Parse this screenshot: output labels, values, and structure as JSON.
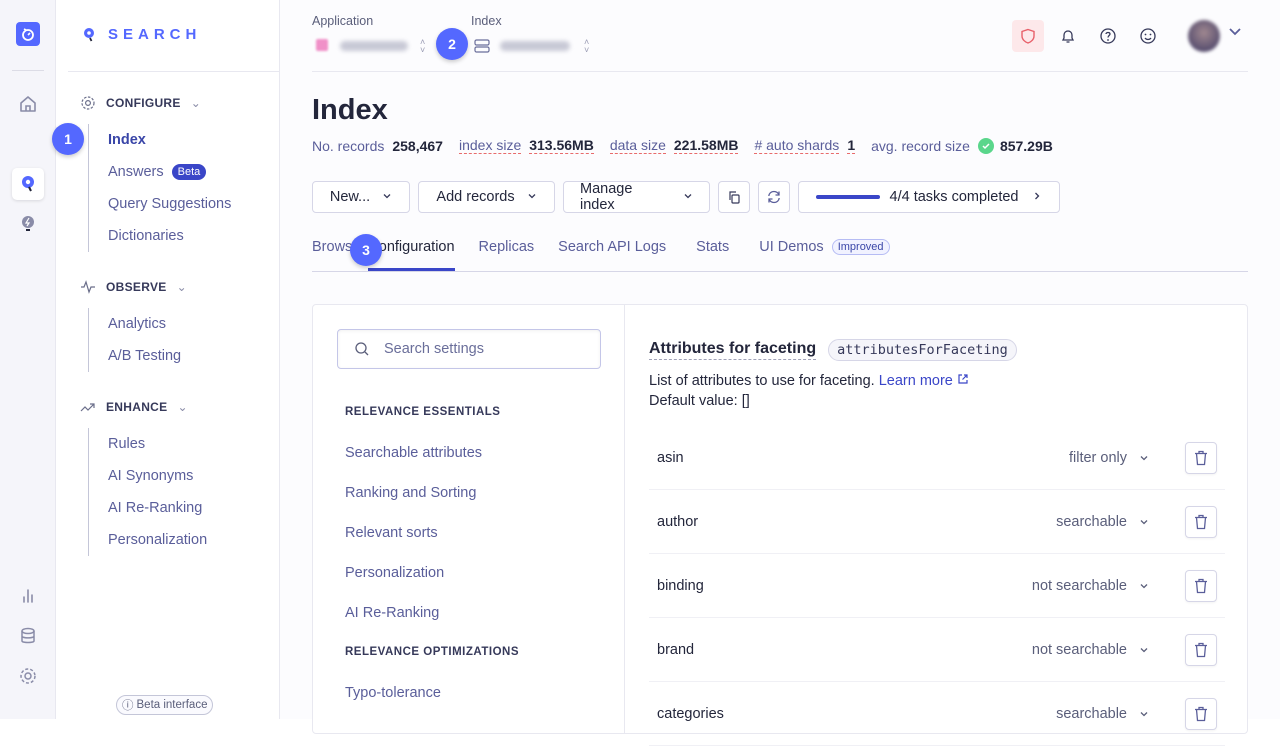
{
  "rail": {
    "icons": [
      "app-logo-icon",
      "home-icon",
      "search-product-icon",
      "ai-bulb-icon",
      "analytics-icon",
      "database-icon",
      "settings-icon"
    ]
  },
  "nav": {
    "logo_text": "SEARCH",
    "sections": [
      {
        "title": "CONFIGURE",
        "items": [
          {
            "label": "Index",
            "selected": true
          },
          {
            "label": "Answers",
            "badge": "Beta"
          },
          {
            "label": "Query Suggestions"
          },
          {
            "label": "Dictionaries"
          }
        ]
      },
      {
        "title": "OBSERVE",
        "items": [
          {
            "label": "Analytics"
          },
          {
            "label": "A/B Testing"
          }
        ]
      },
      {
        "title": "ENHANCE",
        "items": [
          {
            "label": "Rules"
          },
          {
            "label": "AI Synonyms"
          },
          {
            "label": "AI Re-Ranking"
          },
          {
            "label": "Personalization"
          }
        ]
      }
    ],
    "beta_interface": "Beta interface"
  },
  "steps": {
    "one": "1",
    "two": "2",
    "three": "3"
  },
  "topbar": {
    "application_label": "Application",
    "index_label": "Index"
  },
  "page": {
    "title": "Index",
    "stats": {
      "records_label": "No. records",
      "records_value": "258,467",
      "index_size_label": "index size",
      "index_size_value": "313.56MB",
      "data_size_label": "data size",
      "data_size_value": "221.58MB",
      "shards_label": "# auto shards",
      "shards_value": "1",
      "avg_label": "avg. record size",
      "avg_value": "857.29B"
    },
    "toolbar": {
      "new": "New...",
      "add_records": "Add records",
      "manage_index": "Manage index",
      "tasks": "4/4 tasks completed",
      "tasks_progress": 1.0
    },
    "tabs": [
      {
        "label": "Brows"
      },
      {
        "label": "Configuration",
        "selected": true
      },
      {
        "label": "Replicas"
      },
      {
        "label": "Search API Logs"
      },
      {
        "label": "Stats"
      },
      {
        "label": "UI Demos",
        "badge": "Improved"
      }
    ]
  },
  "settings": {
    "search_placeholder": "Search settings",
    "categories": [
      {
        "title": "RELEVANCE ESSENTIALS",
        "items": [
          "Searchable attributes",
          "Ranking and Sorting",
          "Relevant sorts",
          "Personalization",
          "AI Re-Ranking"
        ]
      },
      {
        "title": "RELEVANCE OPTIMIZATIONS",
        "items": [
          "Typo-tolerance"
        ]
      }
    ]
  },
  "facets": {
    "title": "Attributes for faceting",
    "code": "attributesForFaceting",
    "description": "List of attributes to use for faceting.",
    "learn_more": "Learn more",
    "default_value": "Default value: []",
    "rows": [
      {
        "name": "asin",
        "mode": "filter only"
      },
      {
        "name": "author",
        "mode": "searchable"
      },
      {
        "name": "binding",
        "mode": "not searchable"
      },
      {
        "name": "brand",
        "mode": "not searchable"
      },
      {
        "name": "categories",
        "mode": "searchable"
      }
    ]
  },
  "colors": {
    "accent": "#5468ff",
    "primary": "#3a46c8",
    "danger": "#e86b6b",
    "success": "#5ad68b"
  }
}
